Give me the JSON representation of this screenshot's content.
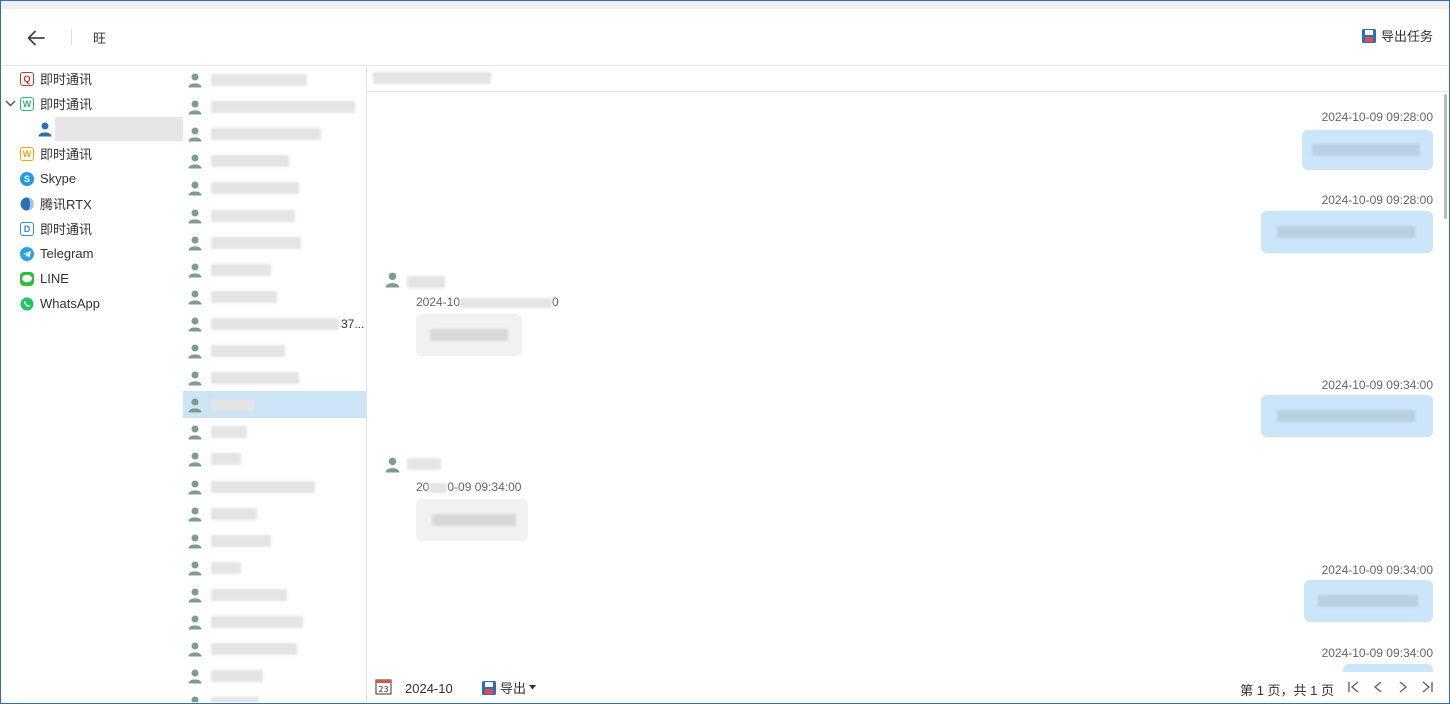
{
  "header": {
    "title": "旺",
    "export_task_label": "导出任务"
  },
  "sidebar": {
    "items": [
      {
        "label": "即时通讯",
        "icon": "qq-icon",
        "color": "#c0392b",
        "glyph": "Q"
      },
      {
        "label": "即时通讯",
        "icon": "wechat-work-icon",
        "color": "#2eb872",
        "glyph": "W",
        "expanded": true
      },
      {
        "label": "即时通讯",
        "icon": "wangwang-icon",
        "color": "#f0a30a",
        "glyph": "W"
      },
      {
        "label": "Skype",
        "icon": "skype-icon",
        "color": "#1e9be0",
        "glyph": "S"
      },
      {
        "label": "腾讯RTX",
        "icon": "rtx-icon",
        "color": "#2f6db5",
        "glyph": ""
      },
      {
        "label": "即时通讯",
        "icon": "dingtalk-icon",
        "color": "#2f8ae6",
        "glyph": "D"
      },
      {
        "label": "Telegram",
        "icon": "telegram-icon",
        "color": "#2aa3e0",
        "glyph": "➤"
      },
      {
        "label": "LINE",
        "icon": "line-icon",
        "color": "#2dbd3b",
        "glyph": "L"
      },
      {
        "label": "WhatsApp",
        "icon": "whatsapp-icon",
        "color": "#25c366",
        "glyph": "✆"
      }
    ]
  },
  "contacts": {
    "count": 24,
    "selected_index": 12,
    "visible_text": {
      "row_9_tail": "37..."
    }
  },
  "messages": [
    {
      "direction": "out",
      "time": "2024-10-09 09:28:00"
    },
    {
      "direction": "out",
      "time": "2024-10-09 09:28:00"
    },
    {
      "direction": "in",
      "time_fragment": "2024-10",
      "time_tail": "0"
    },
    {
      "direction": "out",
      "time": "2024-10-09 09:34:00"
    },
    {
      "direction": "in",
      "time_prefix": "20",
      "time_tail": "0-09 09:34:00"
    },
    {
      "direction": "out",
      "time": "2024-10-09 09:34:00"
    },
    {
      "direction": "out",
      "time": "2024-10-09 09:34:00"
    }
  ],
  "footer": {
    "date": "2024-10",
    "export_label": "导出",
    "page_info": "第 1 页，共 1 页"
  },
  "colors": {
    "accent": "#2f6db5",
    "bubble_out": "#cbe5fa",
    "bubble_in": "#f2f2f2",
    "selection": "#cde4f7",
    "avatar": "#7c9c8c"
  }
}
